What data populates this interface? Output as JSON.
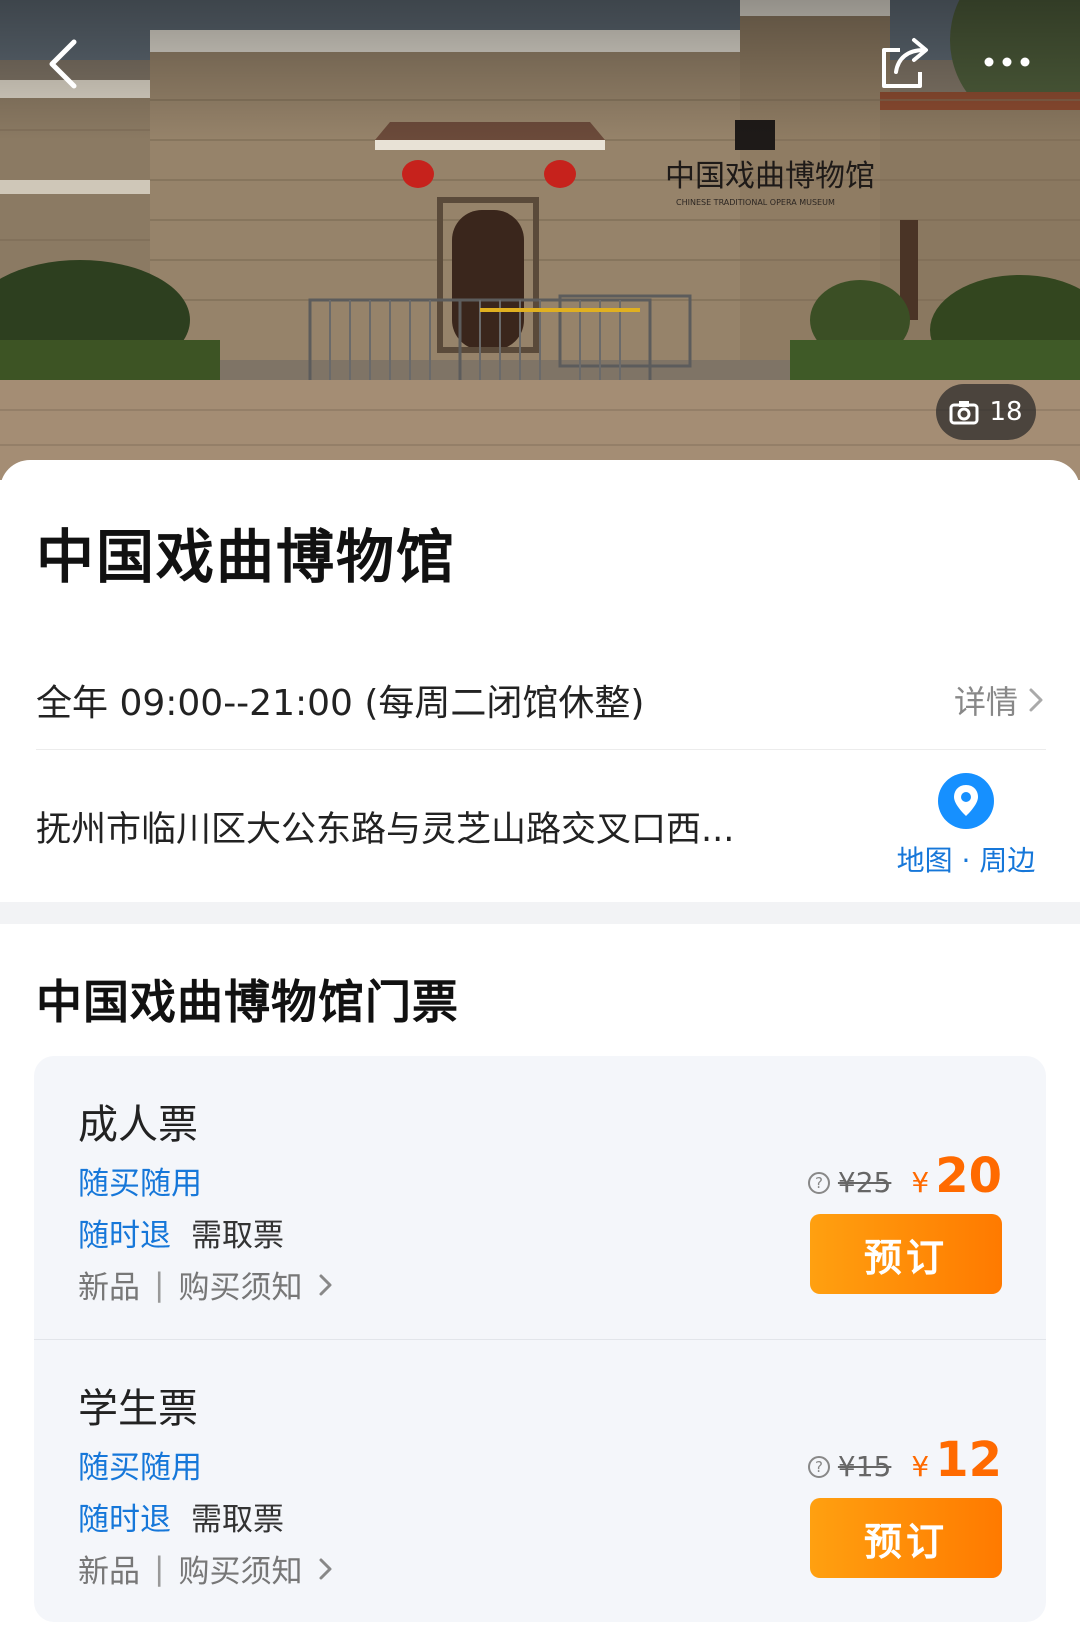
{
  "hero": {
    "photo_count": "18",
    "museum_sign": "中国戏曲博物馆",
    "museum_sign_en": "CHINESE TRADITIONAL OPERA MUSEUM",
    "icons": {
      "back": "back-arrow-icon",
      "share": "share-icon",
      "more": "more-dots-icon",
      "camera": "camera-icon"
    }
  },
  "info": {
    "title": "中国戏曲博物馆",
    "hours": "全年 09:00--21:00 (每周二闭馆休整)",
    "detail_label": "详情",
    "address": "抚州市临川区大公东路与灵芝山路交叉口西...",
    "map_label": "地图 · 周边"
  },
  "tickets": {
    "section_title": "中国戏曲博物馆门票",
    "items": [
      {
        "name": "成人票",
        "tag_buy": "随买随用",
        "tag_refund": "随时退",
        "pickup": "需取票",
        "new_label": "新品",
        "separator": "|",
        "notice_label": "购买须知",
        "original_price": "¥25",
        "currency": "¥",
        "price": "20",
        "book_label": "预订"
      },
      {
        "name": "学生票",
        "tag_buy": "随买随用",
        "tag_refund": "随时退",
        "pickup": "需取票",
        "new_label": "新品",
        "separator": "|",
        "notice_label": "购买须知",
        "original_price": "¥15",
        "currency": "¥",
        "price": "12",
        "book_label": "预订"
      }
    ]
  },
  "colors": {
    "accent_blue": "#1677d9",
    "price_orange": "#ff6a00",
    "button_orange": "#ff8a00"
  }
}
